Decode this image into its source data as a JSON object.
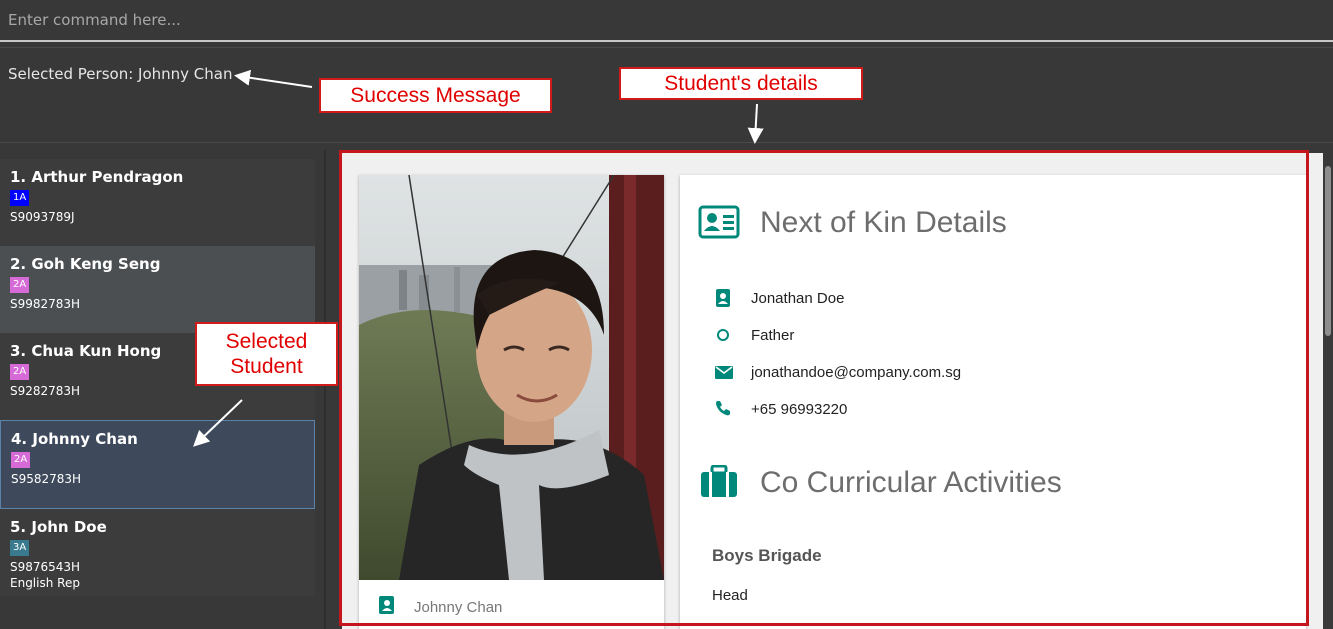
{
  "command_box": {
    "placeholder": "Enter command here..."
  },
  "result_display": {
    "message": "Selected Person: Johnny Chan"
  },
  "person_list": [
    {
      "index_name": "1.  Arthur Pendragon",
      "tag": "1A",
      "tag_color": "#0000ff",
      "nric": "S9093789J",
      "extra": ""
    },
    {
      "index_name": "2.  Goh Keng Seng",
      "tag": "2A",
      "tag_color": "#d66ad6",
      "nric": "S9982783H",
      "extra": ""
    },
    {
      "index_name": "3.  Chua Kun Hong",
      "tag": "2A",
      "tag_color": "#d66ad6",
      "nric": "S9282783H",
      "extra": ""
    },
    {
      "index_name": "4.  Johnny Chan",
      "tag": "2A",
      "tag_color": "#d66ad6",
      "nric": "S9582783H",
      "extra": ""
    },
    {
      "index_name": "5.  John Doe",
      "tag": "3A",
      "tag_color": "#3a7a8f",
      "nric": "S9876543H",
      "extra": "English Rep"
    }
  ],
  "details": {
    "photo_name": "Johnny Chan",
    "next_of_kin": {
      "heading": "Next of Kin Details",
      "name": "Jonathan Doe",
      "relationship": "Father",
      "email": "jonathandoe@company.com.sg",
      "phone": "+65 96993220"
    },
    "cca": {
      "heading": "Co Curricular Activities",
      "name": "Boys Brigade",
      "role": "Head"
    },
    "accent_color": "#00897b"
  },
  "annotations": {
    "success_message": "Success Message",
    "students_details": "Student's details",
    "selected_student_line1": "Selected",
    "selected_student_line2": "Student"
  }
}
